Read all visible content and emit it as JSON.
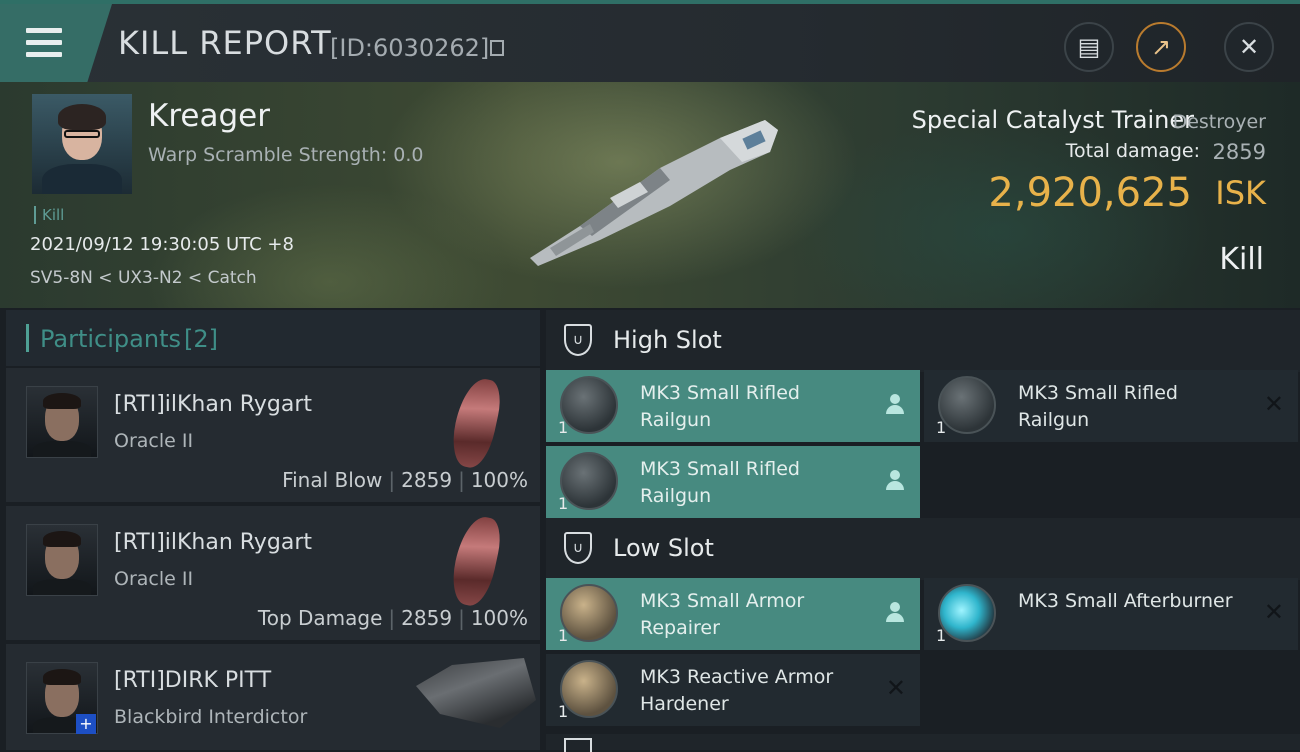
{
  "header": {
    "title": "KILL REPORT",
    "report_id": "[ID:6030262]",
    "buttons": {
      "notes_icon": "clipboard-icon",
      "share_icon": "share-icon",
      "close_icon": "close-icon"
    }
  },
  "victim": {
    "name": "Kreager",
    "warp_scramble": "Warp Scramble Strength: 0.0",
    "tag": "Kill",
    "datetime": "2021/09/12 19:30:05 UTC +8",
    "location": "SV5-8N < UX3-N2 < Catch",
    "ship_name": "Special Catalyst Trainer",
    "ship_class": "Destroyer",
    "total_damage_label": "Total damage:",
    "total_damage": "2859",
    "isk_value": "2,920,625",
    "isk_unit": "ISK",
    "report_type": "Kill"
  },
  "participants": {
    "label": "Participants",
    "count": "[2]",
    "items": [
      {
        "name": "[RTI]ilKhan Rygart",
        "ship": "Oracle II",
        "role": "Final Blow",
        "damage": "2859",
        "percent": "100%"
      },
      {
        "name": "[RTI]ilKhan Rygart",
        "ship": "Oracle II",
        "role": "Top Damage",
        "damage": "2859",
        "percent": "100%"
      },
      {
        "name": "[RTI]DIRK PITT",
        "ship": "Blackbird Interdictor",
        "badge": "+"
      }
    ]
  },
  "slots": {
    "high": {
      "label": "High Slot",
      "modules": [
        {
          "qty": "1",
          "name": "MK3 Small Rifled Railgun",
          "state": "dropped"
        },
        {
          "qty": "1",
          "name": "MK3 Small Rifled Railgun",
          "state": "destroyed",
          "mark": "✕"
        },
        {
          "qty": "1",
          "name": "MK3 Small Rifled Railgun",
          "state": "dropped"
        }
      ]
    },
    "low": {
      "label": "Low Slot",
      "modules": [
        {
          "qty": "1",
          "name": "MK3 Small Armor Repairer",
          "state": "dropped"
        },
        {
          "qty": "1",
          "name": "MK3 Small Afterburner",
          "state": "destroyed",
          "mark": "✕"
        },
        {
          "qty": "1",
          "name": "MK3 Reactive Armor Hardener",
          "state": "destroyed",
          "mark": "✕"
        }
      ]
    }
  },
  "colors": {
    "accent": "#478a80",
    "isk": "#e8b24a",
    "close_orange": "#b97b2e"
  }
}
